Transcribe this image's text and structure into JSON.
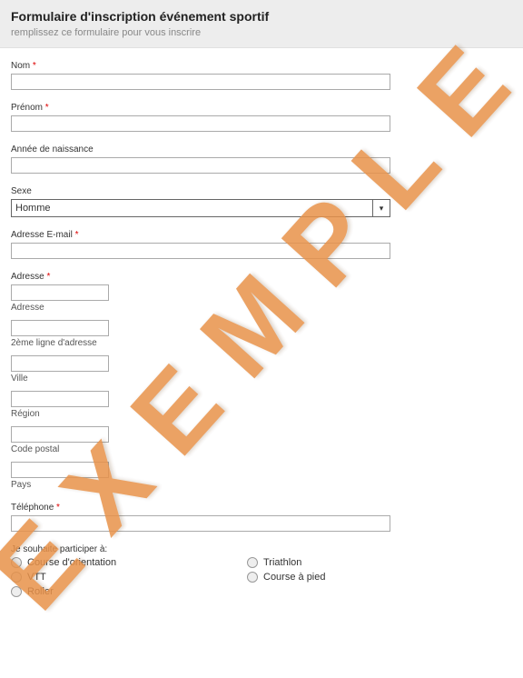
{
  "header": {
    "title": "Formulaire d'inscription événement sportif",
    "subtitle": "remplissez ce formulaire pour vous inscrire"
  },
  "fields": {
    "nom": {
      "label": "Nom",
      "required": true
    },
    "prenom": {
      "label": "Prénom",
      "required": true
    },
    "annee": {
      "label": "Année de naissance",
      "required": false
    },
    "sexe": {
      "label": "Sexe",
      "required": false,
      "value": "Homme"
    },
    "email": {
      "label": "Adresse E-mail",
      "required": true
    },
    "adresse": {
      "label": "Adresse",
      "required": true,
      "sub": {
        "adresse": "Adresse",
        "ligne2": "2ème ligne d'adresse",
        "ville": "Ville",
        "region": "Région",
        "cp": "Code postal",
        "pays": "Pays"
      }
    },
    "tel": {
      "label": "Téléphone",
      "required": true
    },
    "participer": {
      "label": "Je souhaite participer à:",
      "options_left": [
        "Course d'orientation",
        "VTT",
        "Roller"
      ],
      "options_right": [
        "Triathlon",
        "Course à pied"
      ]
    }
  },
  "watermark": "EXEMPLE",
  "required_marker": "*"
}
